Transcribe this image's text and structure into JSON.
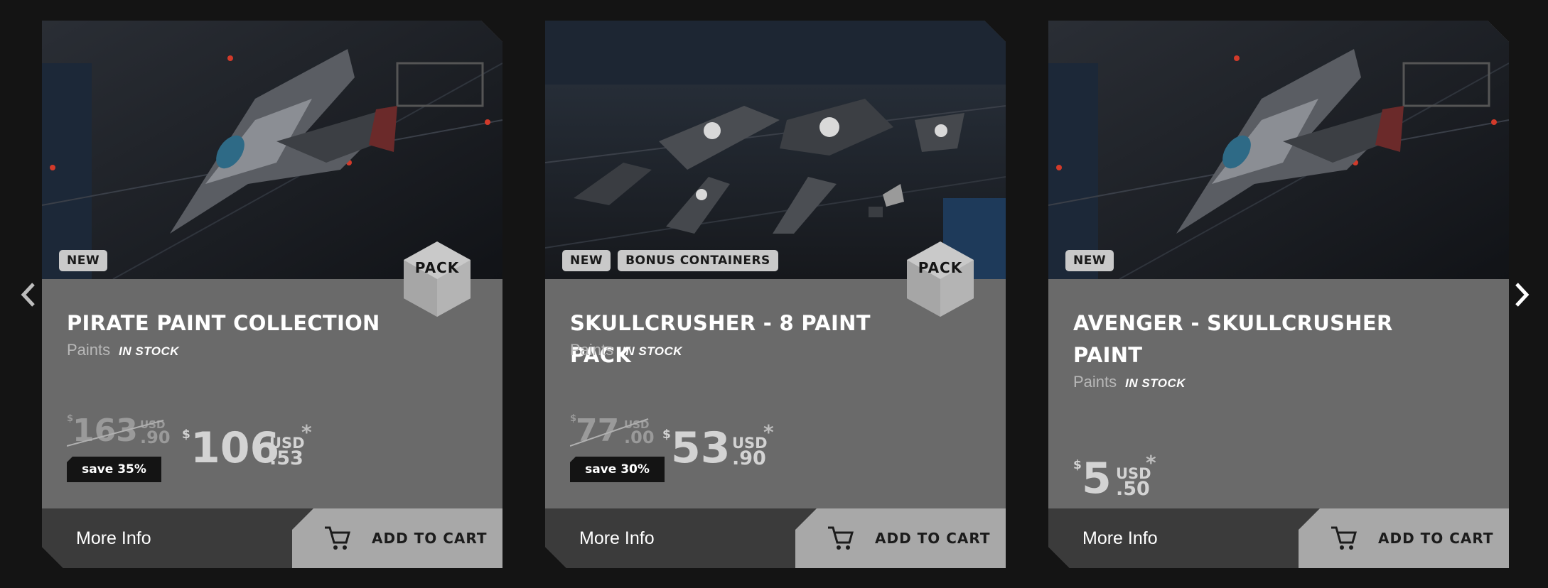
{
  "carousel": {
    "prev_icon": "chevron-left-icon",
    "next_icon": "chevron-right-icon"
  },
  "cards": [
    {
      "title": "PIRATE PAINT COLLECTION",
      "category": "Paints",
      "stock": "IN STOCK",
      "badges": [
        "NEW"
      ],
      "pack_label": "PACK",
      "old_price": {
        "currency": "$",
        "whole": "163",
        "unit": "USD",
        "cents": ".90"
      },
      "price": {
        "currency": "$",
        "whole": "106",
        "unit": "USD",
        "cents": ".53",
        "asterisk": "*"
      },
      "save_label": "save 35%",
      "more_info": "More Info",
      "add_to_cart": "ADD TO CART"
    },
    {
      "title": "SKULLCRUSHER - 8 PAINT PACK",
      "category": "Paints",
      "stock": "IN STOCK",
      "badges": [
        "NEW",
        "BONUS CONTAINERS"
      ],
      "pack_label": "PACK",
      "old_price": {
        "currency": "$",
        "whole": "77",
        "unit": "USD",
        "cents": ".00"
      },
      "price": {
        "currency": "$",
        "whole": "53",
        "unit": "USD",
        "cents": ".90",
        "asterisk": "*"
      },
      "save_label": "save 30%",
      "more_info": "More Info",
      "add_to_cart": "ADD TO CART"
    },
    {
      "title_line1": "AVENGER - SKULLCRUSHER",
      "title_line2": "PAINT",
      "category": "Paints",
      "stock": "IN STOCK",
      "badges": [
        "NEW"
      ],
      "price": {
        "currency": "$",
        "whole": "5",
        "unit": "USD",
        "cents": ".50",
        "asterisk": "*"
      },
      "more_info": "More Info",
      "add_to_cart": "ADD TO CART"
    }
  ],
  "colors": {
    "page_bg": "#141414",
    "card_bg": "#6a6a6a",
    "footer_bg": "#3b3b3b",
    "cart_button_bg": "#a8a8a8",
    "badge_bg": "#c9c9c9"
  }
}
